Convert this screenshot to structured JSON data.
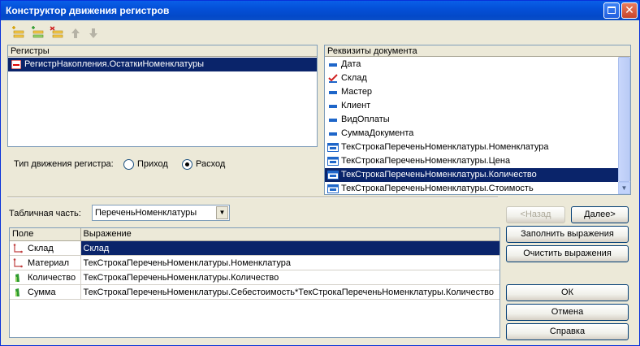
{
  "window": {
    "title": "Конструктор движения регистров"
  },
  "toolbar": {
    "icons": [
      "add-row-icon",
      "add-copy-icon",
      "delete-row-icon",
      "move-up-icon",
      "move-down-icon"
    ]
  },
  "registers": {
    "header": "Регистры",
    "items": [
      {
        "label": "РегистрНакопления.ОстаткиНоменклатуры",
        "selected": true
      }
    ]
  },
  "movement_type": {
    "label": "Тип движения регистра:",
    "options": [
      {
        "label": "Приход",
        "checked": false
      },
      {
        "label": "Расход",
        "checked": true
      }
    ]
  },
  "attributes": {
    "header": "Реквизиты документа",
    "items": [
      {
        "label": "Дата",
        "icon": "attribute-icon"
      },
      {
        "label": "Склад",
        "icon": "check-icon"
      },
      {
        "label": "Мастер",
        "icon": "attribute-icon"
      },
      {
        "label": "Клиент",
        "icon": "attribute-icon"
      },
      {
        "label": "ВидОплаты",
        "icon": "attribute-icon"
      },
      {
        "label": "СуммаДокумента",
        "icon": "attribute-icon"
      },
      {
        "label": "ТекСтрокаПереченьНоменклатуры.Номенклатура",
        "icon": "table-icon"
      },
      {
        "label": "ТекСтрокаПереченьНоменклатуры.Цена",
        "icon": "table-icon"
      },
      {
        "label": "ТекСтрокаПереченьНоменклатуры.Количество",
        "icon": "table-icon",
        "selected": true
      },
      {
        "label": "ТекСтрокаПереченьНоменклатуры.Стоимость",
        "icon": "table-icon"
      }
    ]
  },
  "tabular": {
    "label": "Табличная часть:",
    "value": "ПереченьНоменклатуры"
  },
  "buttons": {
    "back": "<Назад",
    "next": "Далее>",
    "fill": "Заполнить выражения",
    "clear": "Очистить выражения",
    "ok": "ОК",
    "cancel": "Отмена",
    "help": "Справка"
  },
  "grid": {
    "columns": [
      "Поле",
      "Выражение"
    ],
    "rows": [
      {
        "field": "Склад",
        "expression": "Склад",
        "kind": "dimension",
        "selected": true
      },
      {
        "field": "Материал",
        "expression": "ТекСтрокаПереченьНоменклатуры.Номенклатура",
        "kind": "dimension"
      },
      {
        "field": "Количество",
        "expression": "ТекСтрокаПереченьНоменклатуры.Количество",
        "kind": "resource"
      },
      {
        "field": "Сумма",
        "expression": "ТекСтрокаПереченьНоменклатуры.Себестоимость*ТекСтрокаПереченьНоменклатуры.Количество",
        "kind": "resource"
      }
    ]
  },
  "colors": {
    "selection": "#0A246A",
    "title_bar": "#0450D8",
    "face": "#ECE9D8"
  }
}
